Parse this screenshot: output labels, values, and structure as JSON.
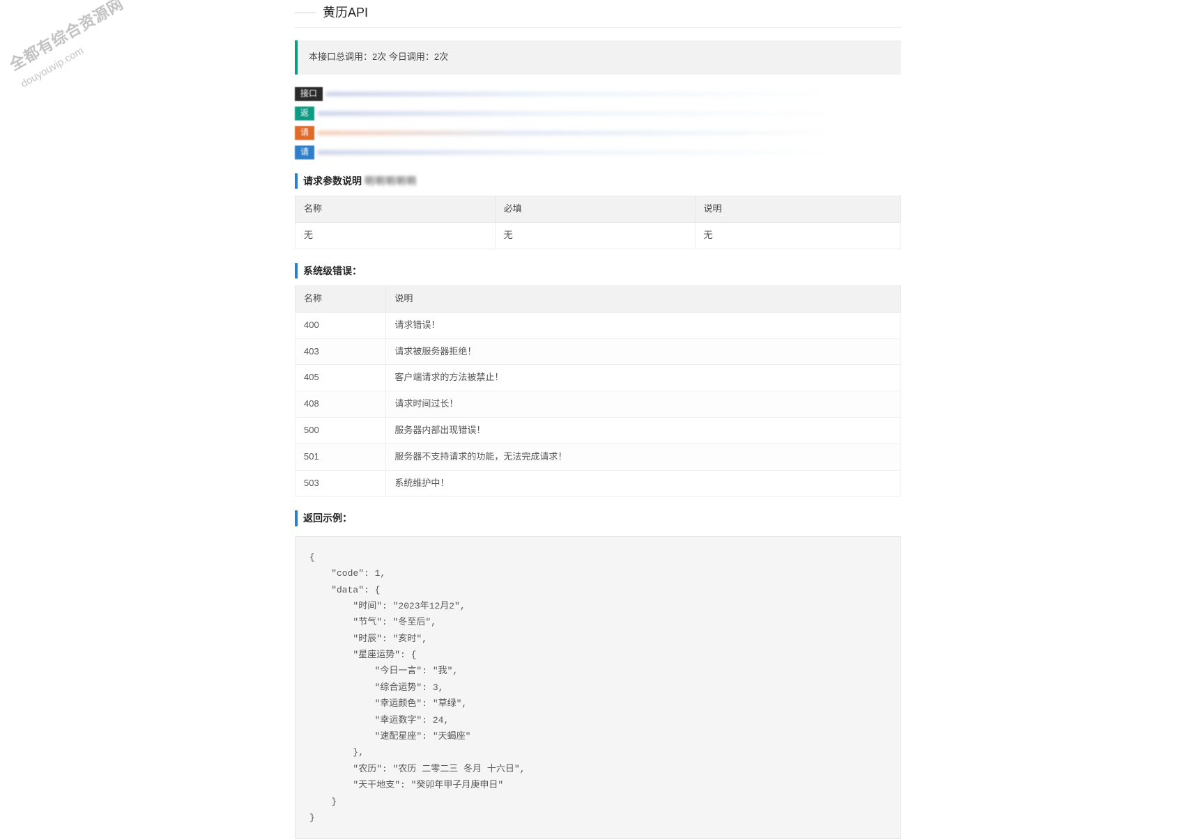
{
  "watermark": {
    "line1": "全都有综合资源网",
    "line2": "douyouvip.com"
  },
  "title": "黄历API",
  "call_stats": "本接口总调用：2次 今日调用：2次",
  "info_bars": [
    {
      "tag": "接口"
    },
    {
      "tag": "返"
    },
    {
      "tag": "请"
    },
    {
      "tag": "请"
    }
  ],
  "sections": {
    "params_heading": "请求参数说明",
    "params_blur": "明明明明明",
    "errors_heading": "系统级错误：",
    "response_heading": "返回示例："
  },
  "params_table": {
    "headers": [
      "名称",
      "必填",
      "说明"
    ],
    "rows": [
      [
        "无",
        "无",
        "无"
      ]
    ]
  },
  "errors_table": {
    "headers": [
      "名称",
      "说明"
    ],
    "rows": [
      [
        "400",
        "请求错误！"
      ],
      [
        "403",
        "请求被服务器拒绝！"
      ],
      [
        "405",
        "客户端请求的方法被禁止！"
      ],
      [
        "408",
        "请求时间过长！"
      ],
      [
        "500",
        "服务器内部出现错误！"
      ],
      [
        "501",
        "服务器不支持请求的功能，无法完成请求！"
      ],
      [
        "503",
        "系统维护中！"
      ]
    ]
  },
  "response_example": "{\n    \"code\": 1,\n    \"data\": {\n        \"时间\": \"2023年12月2\",\n        \"节气\": \"冬至后\",\n        \"时辰\": \"亥时\",\n        \"星座运势\": {\n            \"今日一言\": \"我\",\n            \"综合运势\": 3,\n            \"幸运颜色\": \"草绿\",\n            \"幸运数字\": 24,\n            \"速配星座\": \"天蝎座\"\n        },\n        \"农历\": \"农历 二零二三 冬月 十六日\",\n        \"天干地支\": \"癸卯年甲子月庚申日\"\n    }\n}"
}
